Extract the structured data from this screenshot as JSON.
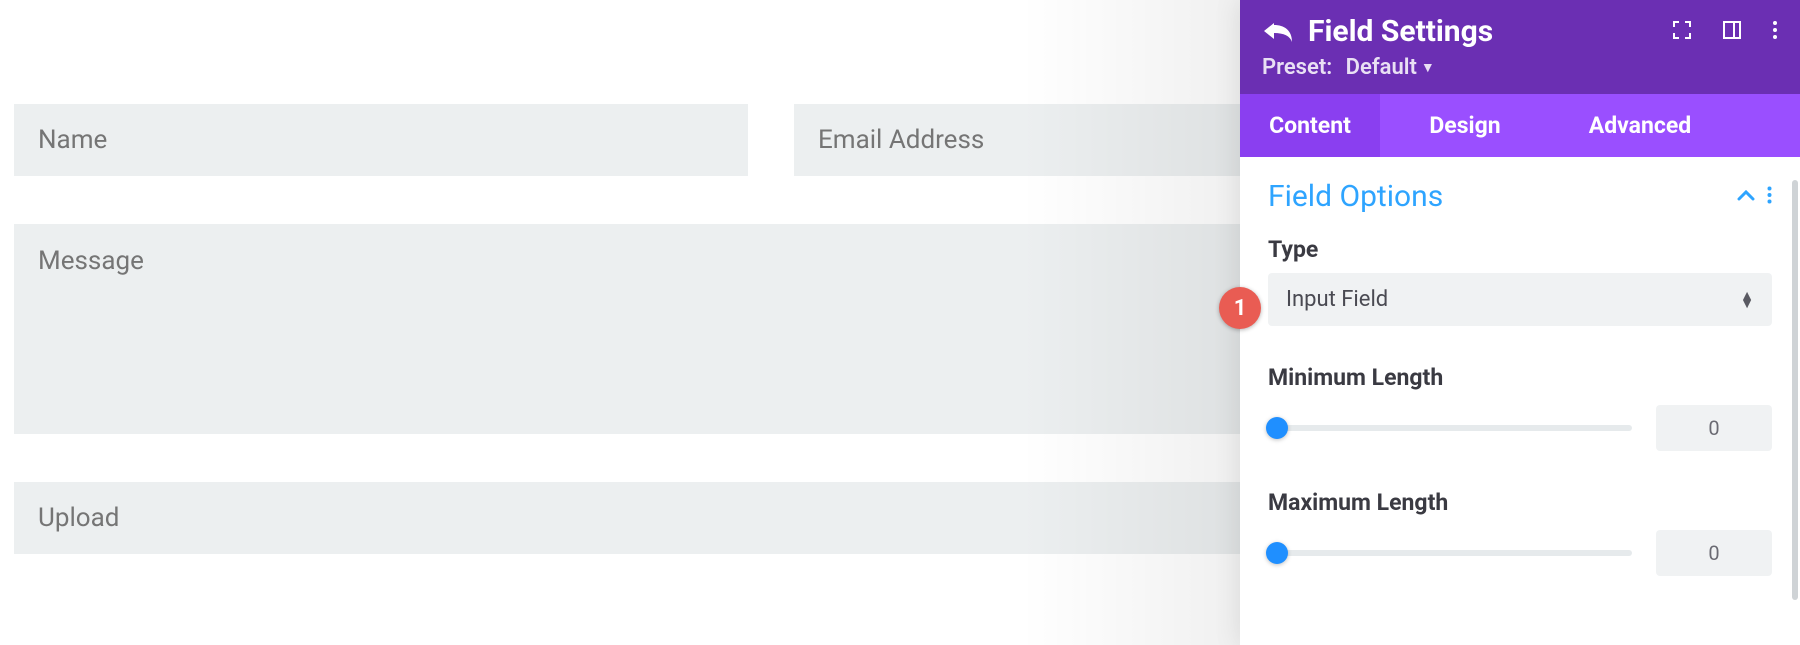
{
  "form": {
    "name_placeholder": "Name",
    "email_placeholder": "Email Address",
    "message_placeholder": "Message",
    "upload_placeholder": "Upload"
  },
  "panel": {
    "title": "Field Settings",
    "preset_label": "Preset:",
    "preset_value": "Default",
    "tabs": {
      "content": "Content",
      "design": "Design",
      "advanced": "Advanced"
    },
    "section_title": "Field Options",
    "type_label": "Type",
    "type_value": "Input Field",
    "min_label": "Minimum Length",
    "min_value": "0",
    "max_label": "Maximum Length",
    "max_value": "0"
  },
  "badges": {
    "step1": "1"
  }
}
